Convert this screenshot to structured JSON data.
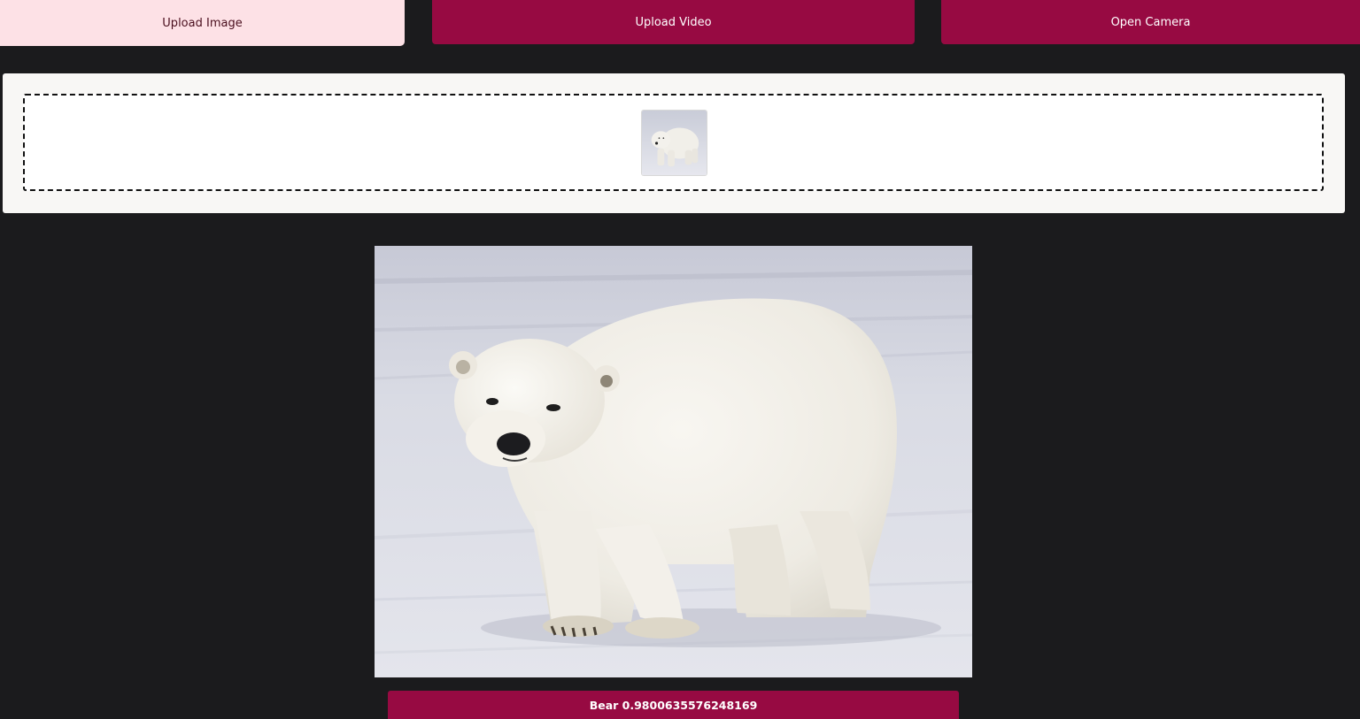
{
  "tabs": {
    "upload_image": "Upload Image",
    "upload_video": "Upload Video",
    "open_camera": "Open Camera"
  },
  "colors": {
    "background": "#1b1b1d",
    "accent": "#970a42",
    "active_tab": "#fde1e6",
    "panel": "#f8f7f5"
  },
  "result": {
    "label": "Bear",
    "score": "0.9800635576248169",
    "text": "Bear 0.9800635576248169"
  }
}
